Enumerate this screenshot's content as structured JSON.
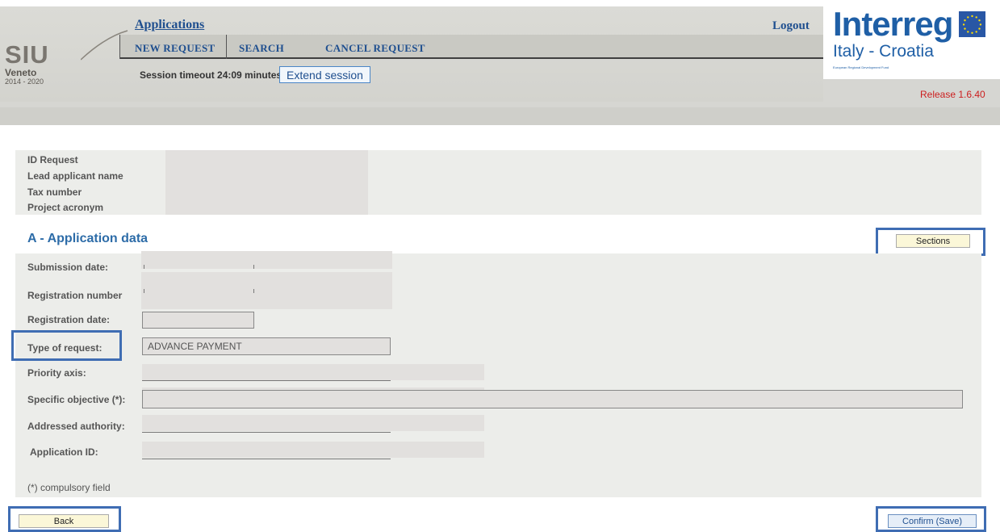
{
  "header": {
    "logo_text": "SIU",
    "logo_region": "Veneto",
    "logo_years": "2014 - 2020",
    "app_title": "Applications",
    "menu": [
      {
        "label": "NEW REQUEST"
      },
      {
        "label": "SEARCH"
      },
      {
        "label": "CANCEL REQUEST"
      }
    ],
    "session_text": "Session timeout 24:09 minutes",
    "extend_label": "Extend session",
    "logout_label": "Logout",
    "program_name": "Interreg",
    "program_sub": "Italy - Croatia",
    "fund_text": "European Regional Development Fund",
    "release": "Release 1.6.40"
  },
  "info": {
    "labels": [
      "ID Request",
      "Lead applicant name",
      "Tax number",
      "Project acronym"
    ]
  },
  "section_a": {
    "title": "A - Application data",
    "sections_button": "Sections",
    "fields": {
      "submission_date": {
        "label": "Submission date:"
      },
      "registration_number": {
        "label": "Registration number"
      },
      "registration_date": {
        "label": "Registration date:",
        "value": ""
      },
      "type_of_request": {
        "label": "Type of request:",
        "value": "ADVANCE PAYMENT"
      },
      "priority_axis": {
        "label": "Priority axis:"
      },
      "specific_objective": {
        "label": "Specific objective (*):"
      },
      "addressed_authority": {
        "label": "Addressed authority:"
      },
      "application_id": {
        "label": "Application ID:"
      }
    },
    "compulsory_note": "(*) compulsory field"
  },
  "footer": {
    "back_button": "Back",
    "confirm_button": "Confirm (Save)"
  },
  "colors": {
    "accent_blue": "#1f4f8f",
    "highlight_border": "#3f6db3",
    "release_red": "#cc1e1e",
    "panel_bg": "#ecedea"
  }
}
